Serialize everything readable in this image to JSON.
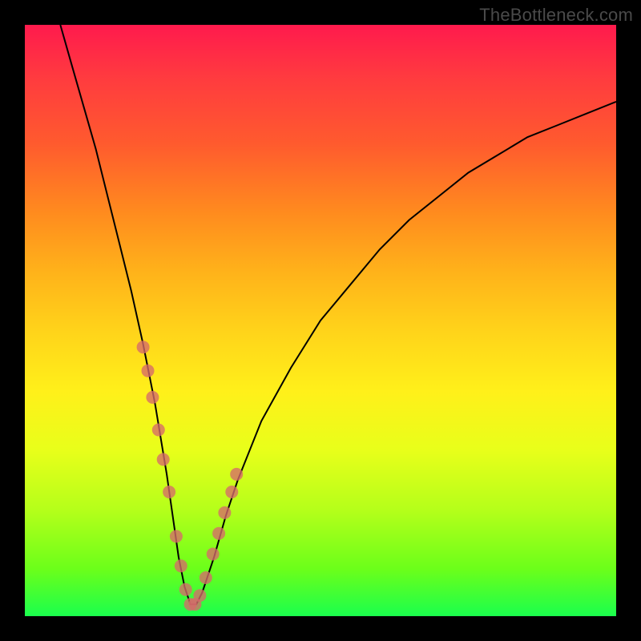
{
  "watermark": "TheBottleneck.com",
  "chart_data": {
    "type": "line",
    "title": "",
    "xlabel": "",
    "ylabel": "",
    "xlim": [
      0,
      100
    ],
    "ylim": [
      0,
      100
    ],
    "grid": false,
    "series": [
      {
        "name": "bottleneck-curve",
        "x": [
          6,
          8,
          10,
          12,
          14,
          16,
          18,
          20,
          22,
          24,
          25,
          26,
          27,
          28,
          29,
          30,
          32,
          34,
          36,
          40,
          45,
          50,
          55,
          60,
          65,
          70,
          75,
          80,
          85,
          90,
          95,
          100
        ],
        "y": [
          100,
          93,
          86,
          79,
          71,
          63,
          55,
          46,
          36,
          24,
          17,
          10,
          5,
          2,
          2,
          4,
          10,
          17,
          23,
          33,
          42,
          50,
          56,
          62,
          67,
          71,
          75,
          78,
          81,
          83,
          85,
          87
        ]
      }
    ],
    "markers": {
      "name": "sample-points",
      "x": [
        20.0,
        20.8,
        21.6,
        22.6,
        23.4,
        24.4,
        25.6,
        26.4,
        27.2,
        28.0,
        28.8,
        29.6,
        30.6,
        31.8,
        32.8,
        33.8,
        35.0,
        35.8
      ],
      "y": [
        45.5,
        41.5,
        37.0,
        31.5,
        26.5,
        21.0,
        13.5,
        8.5,
        4.5,
        2.0,
        2.0,
        3.5,
        6.5,
        10.5,
        14.0,
        17.5,
        21.0,
        24.0
      ]
    },
    "gradient_stops": [
      {
        "pos": 0.0,
        "color": "#ff1a4d"
      },
      {
        "pos": 0.2,
        "color": "#ff5a2e"
      },
      {
        "pos": 0.42,
        "color": "#ffb31a"
      },
      {
        "pos": 0.62,
        "color": "#fff01a"
      },
      {
        "pos": 0.82,
        "color": "#b5ff1a"
      },
      {
        "pos": 1.0,
        "color": "#1aff4d"
      }
    ]
  }
}
